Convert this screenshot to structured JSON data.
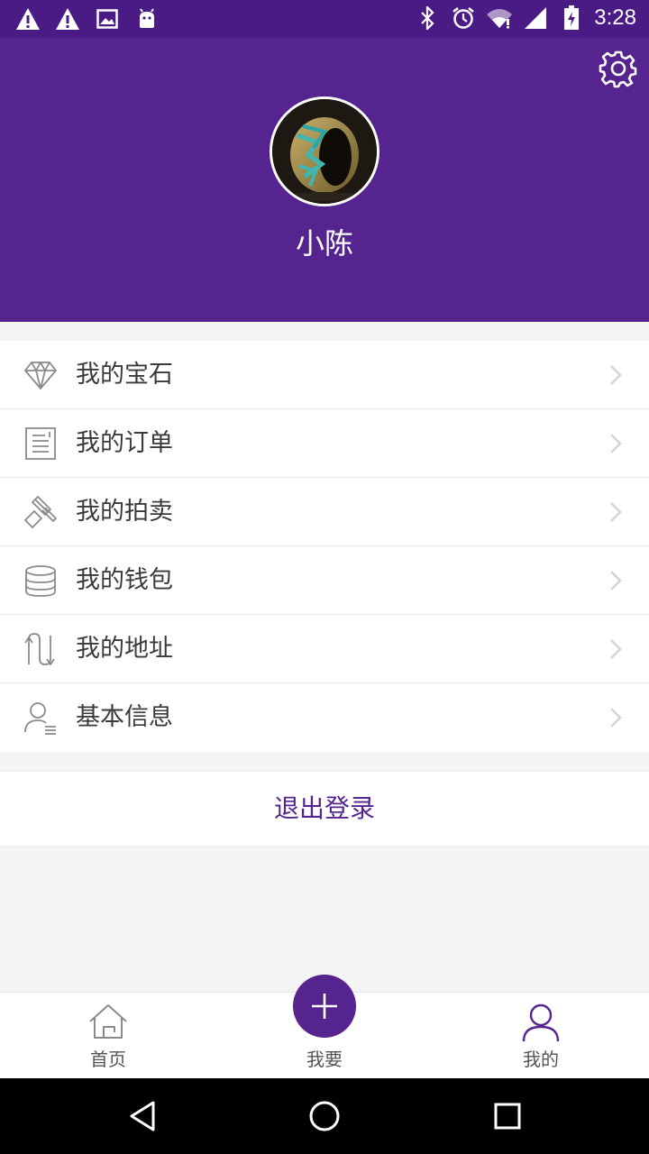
{
  "status_bar": {
    "time": "3:28",
    "left_icons": [
      "warning-icon",
      "warning-icon",
      "image-icon",
      "android-icon"
    ],
    "right_icons": [
      "bluetooth-icon",
      "alarm-icon",
      "wifi-icon",
      "signal-icon",
      "battery-charging-icon"
    ]
  },
  "header": {
    "username": "小陈",
    "background_color": "#55248f",
    "settings_icon": "gear-icon"
  },
  "menu": {
    "items": [
      {
        "label": "我的宝石",
        "icon": "diamond-icon"
      },
      {
        "label": "我的订单",
        "icon": "document-icon"
      },
      {
        "label": "我的拍卖",
        "icon": "gavel-icon"
      },
      {
        "label": "我的钱包",
        "icon": "coins-icon"
      },
      {
        "label": "我的地址",
        "icon": "route-icon"
      },
      {
        "label": "基本信息",
        "icon": "user-info-icon"
      }
    ]
  },
  "logout": {
    "label": "退出登录"
  },
  "tabbar": {
    "tabs": [
      {
        "label": "首页",
        "icon": "home-icon"
      },
      {
        "label": "我要",
        "icon": "plus-icon"
      },
      {
        "label": "我的",
        "icon": "user-icon"
      }
    ],
    "accent_color": "#55248f"
  },
  "navbar": {
    "buttons": [
      "back-icon",
      "home-circle-icon",
      "recents-icon"
    ]
  }
}
